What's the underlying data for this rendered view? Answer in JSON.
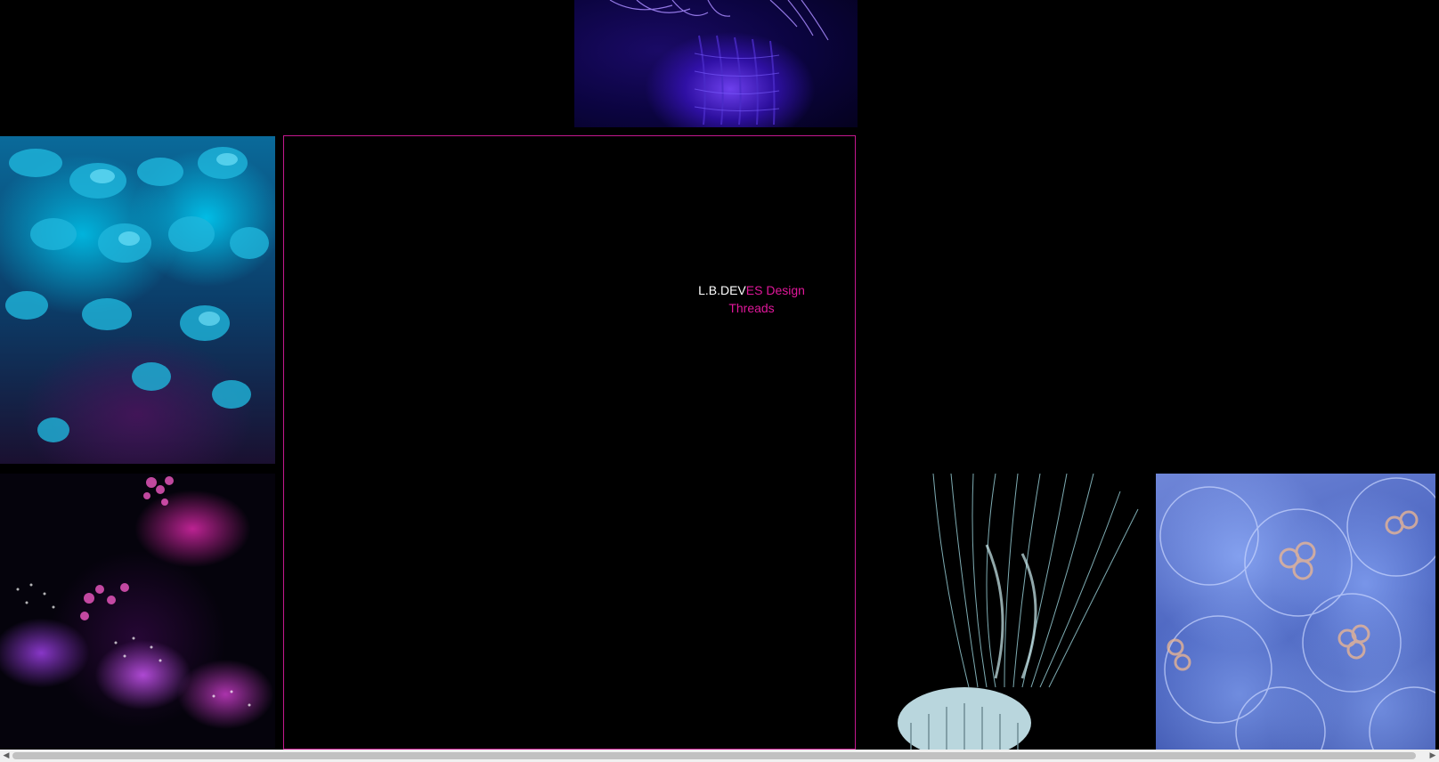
{
  "brand": {
    "part1": "L.B.DEV",
    "part2": "ES Design",
    "part3": "Threads"
  },
  "colors": {
    "background": "#000000",
    "accent": "#e0179a",
    "panel_border": "#c4188e",
    "brand_white": "#ffffff"
  },
  "images": [
    {
      "name": "purple-anemone-image"
    },
    {
      "name": "blue-coral-image"
    },
    {
      "name": "pink-jellyfish-image"
    },
    {
      "name": "white-jellyfish-image"
    },
    {
      "name": "moon-jellyfish-image"
    }
  ],
  "scrollbar": {
    "left_arrow_icon": "triangle-left-icon",
    "right_arrow_icon": "triangle-right-icon"
  }
}
